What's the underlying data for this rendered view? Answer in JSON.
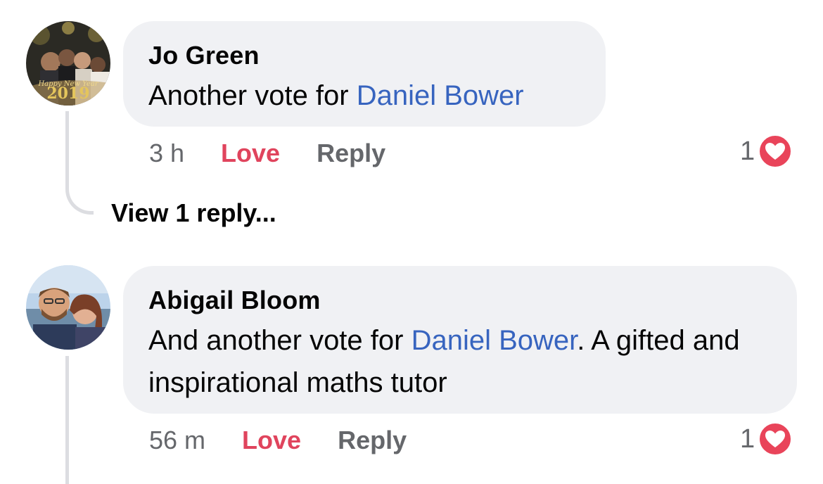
{
  "comments": [
    {
      "author": "Jo Green",
      "text_before": "Another vote for ",
      "mention": "Daniel Bower",
      "text_after": "",
      "time": "3 h",
      "love_label": "Love",
      "reply_label": "Reply",
      "reaction_count": "1",
      "reaction_icon": "heart-icon",
      "view_replies": "View 1 reply...",
      "avatar_overlay_text": "Happy New Year 2019"
    },
    {
      "author": "Abigail Bloom",
      "text_before": "And another vote for ",
      "mention": "Daniel Bower",
      "text_after": ". A gifted and inspirational maths tutor",
      "time": "56 m",
      "love_label": "Love",
      "reply_label": "Reply",
      "reaction_count": "1",
      "reaction_icon": "heart-icon"
    }
  ],
  "colors": {
    "bubble": "#f0f1f4",
    "mention": "#3764bf",
    "love": "#e0445d",
    "meta": "#65676b",
    "heart": "#e9445a"
  }
}
